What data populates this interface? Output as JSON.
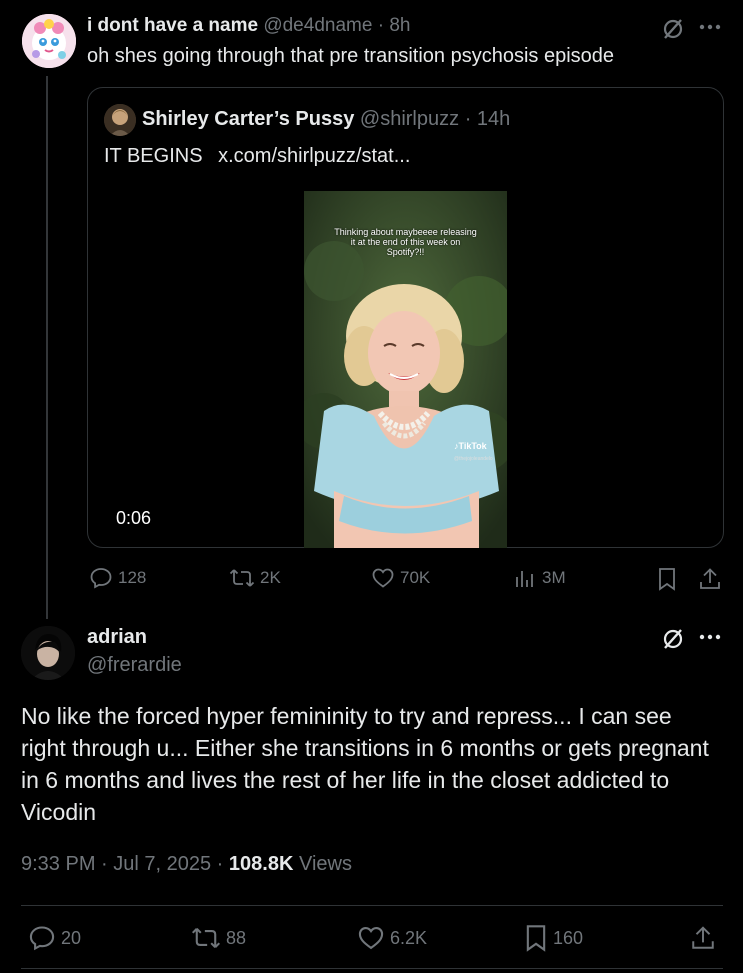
{
  "tweet1": {
    "display_name": "i dont have a name",
    "handle": "@de4dname",
    "time": "8h",
    "text": "oh shes going through that pre transition psychosis episode",
    "quote": {
      "display_name": "Shirley Carter’s Pussy",
      "handle": "@shirlpuzz",
      "time": "14h",
      "text": "IT BEGINS",
      "link": "x.com/shirlpuzz/stat...",
      "video_duration": "0:06",
      "video_caption": "Thinking about maybeeee releasing it at the end of this week on Spotify?!!",
      "video_watermark": "TikTok",
      "video_watermark_handle": "@thejojoleandelo"
    },
    "actions": {
      "replies": "128",
      "reposts": "2K",
      "likes": "70K",
      "views": "3M"
    }
  },
  "tweet2": {
    "display_name": "adrian",
    "handle": "@frerardie",
    "text": "No like the forced hyper femininity to try and repress... I can see right through u... Either she transitions in 6 months or gets pregnant in 6 months and lives the rest of her life in the closet addicted to Vicodin",
    "timestamp": "9:33 PM · Jul 7, 2025",
    "views_count": "108.8K",
    "views_label": "Views",
    "actions": {
      "replies": "20",
      "reposts": "88",
      "likes": "6.2K",
      "bookmarks": "160"
    }
  },
  "colors": {
    "background": "#000000",
    "text": "#e7e9ea",
    "muted": "#71767b",
    "border": "#2f3336"
  }
}
